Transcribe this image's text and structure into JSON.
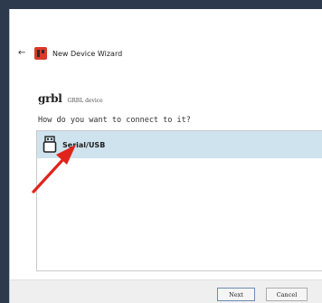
{
  "window": {
    "title": "New Device Wizard",
    "back_icon": "back-arrow-icon",
    "app_icon": "app-logo-icon"
  },
  "device": {
    "logo": "grbl",
    "label": "GRBL device"
  },
  "prompt": {
    "question": "How do you want to connect to it?"
  },
  "connections": [
    {
      "label": "Serial/USB",
      "icon": "usb-icon",
      "selected": true
    }
  ],
  "footer": {
    "next_label": "Next",
    "cancel_label": "Cancel"
  },
  "annotation": {
    "arrow_color": "#e0241b",
    "highlight_color": "#cfe3ee"
  }
}
